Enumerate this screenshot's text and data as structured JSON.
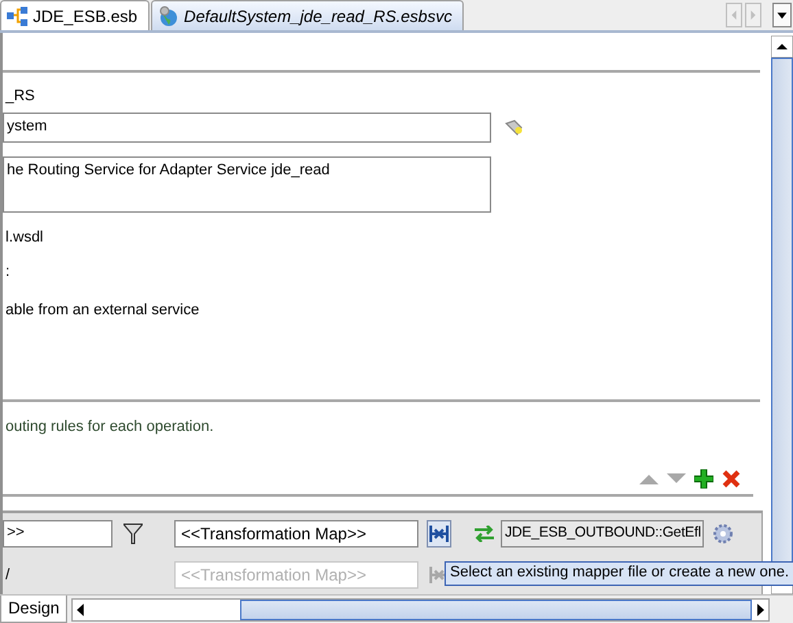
{
  "tabs": [
    {
      "label": "JDE_ESB.esb",
      "selected": false,
      "kind": "diagram"
    },
    {
      "label": "DefaultSystem_jde_read_RS.esbsvc",
      "selected": true,
      "kind": "service"
    }
  ],
  "form": {
    "name_text": "_RS",
    "system_field": {
      "value": "ystem"
    },
    "description_field": {
      "value": "he Routing Service for Adapter Service jde_read"
    },
    "wsdl_text": "l.wsdl",
    "colon_text": ":",
    "invocable_text": "able from an external service"
  },
  "routing": {
    "hint": "outing rules for each operation.",
    "rows": [
      {
        "filter_value": ">>",
        "transformation": "<<Transformation Map>>",
        "disabled": false,
        "target": "JDE_ESB_OUTBOUND::GetEfl"
      },
      {
        "label": "/",
        "transformation": "<<Transformation Map>>",
        "disabled": true
      }
    ]
  },
  "tooltip": "Select an existing mapper file or create a new one.",
  "bottom_tabs": [
    {
      "label": "Design",
      "selected": true
    }
  ]
}
